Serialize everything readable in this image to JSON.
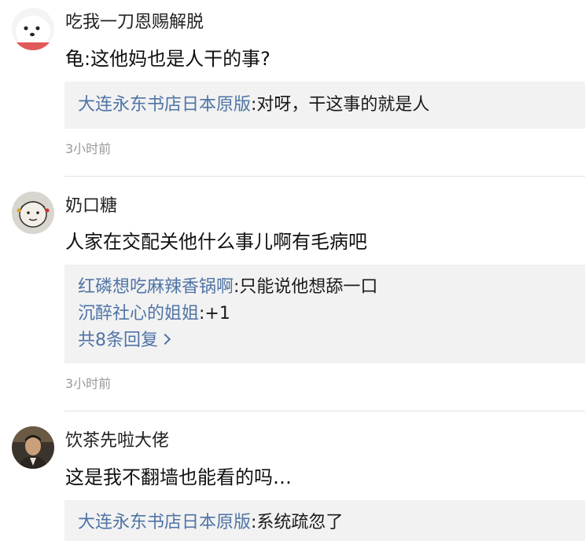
{
  "comments": [
    {
      "username": "吃我一刀恩赐解脱",
      "content": "龟:这他妈也是人干的事?",
      "avatar": "white-dog-avatar",
      "replies": [
        {
          "user": "大连永东书店日本原版",
          "text": ":对呀，干这事的就是人"
        }
      ],
      "time": "3小时前"
    },
    {
      "username": "奶口糖",
      "content": "人家在交配关他什么事儿啊有毛病吧",
      "avatar": "cartoon-face-avatar",
      "replies": [
        {
          "user": "红磷想吃麻辣香锅啊",
          "text": ":只能说他想舔一口"
        },
        {
          "user": "沉醉社心的姐姐",
          "text": ":+1"
        }
      ],
      "more": "共8条回复",
      "time": "3小时前"
    },
    {
      "username": "饮茶先啦大佬",
      "content": "这是我不翻墙也能看的吗…",
      "avatar": "man-photo-avatar",
      "replies": [
        {
          "user": "大连永东书店日本原版",
          "text": ":系统疏忽了"
        }
      ]
    }
  ],
  "colors": {
    "link": "#4f74a6",
    "reply_bg": "#f2f2f2",
    "time": "#999999"
  }
}
